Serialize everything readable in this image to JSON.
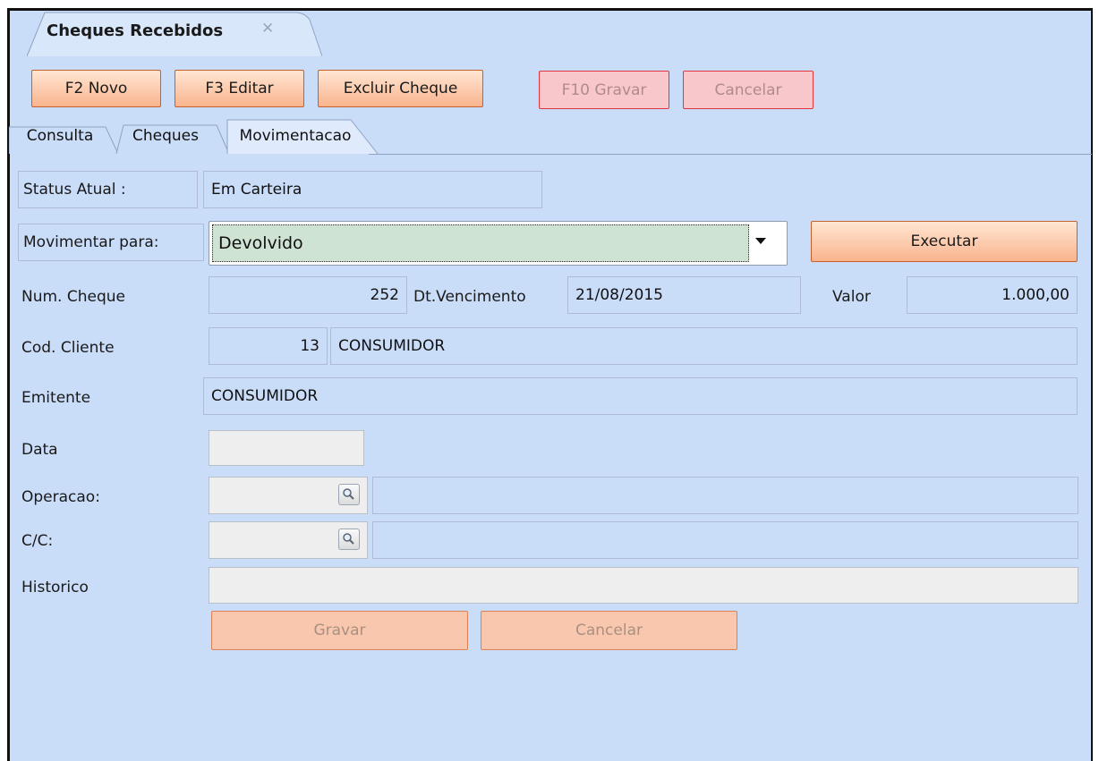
{
  "window": {
    "title": "Cheques Recebidos",
    "close_glyph": "✕"
  },
  "toolbar": {
    "novo": "F2 Novo",
    "editar": "F3 Editar",
    "excluir": "Excluir Cheque",
    "gravar": "F10 Gravar",
    "cancelar": "Cancelar"
  },
  "tabs": [
    "Consulta",
    "Cheques",
    "Movimentacao"
  ],
  "active_tab": "Movimentacao",
  "form": {
    "status_label": "Status Atual :",
    "status_value": "Em Carteira",
    "movimentar_label": "Movimentar para:",
    "movimentar_value": "Devolvido",
    "executar": "Executar",
    "num_cheque_label": "Num. Cheque",
    "num_cheque_value": "252",
    "vencimento_label": "Dt.Vencimento",
    "vencimento_value": "21/08/2015",
    "valor_label": "Valor",
    "valor_value": "1.000,00",
    "cod_cliente_label": "Cod. Cliente",
    "cod_cliente_value": "13",
    "cliente_nome": "CONSUMIDOR",
    "emitente_label": "Emitente",
    "emitente_value": "CONSUMIDOR",
    "data_label": "Data",
    "operacao_label": "Operacao:",
    "cc_label": "C/C:",
    "historico_label": "Historico",
    "gravar": "Gravar",
    "cancelar": "Cancelar"
  },
  "colors": {
    "background": "#c9dcf8",
    "button_border": "#c8602c",
    "alert_border": "#e0343f"
  }
}
